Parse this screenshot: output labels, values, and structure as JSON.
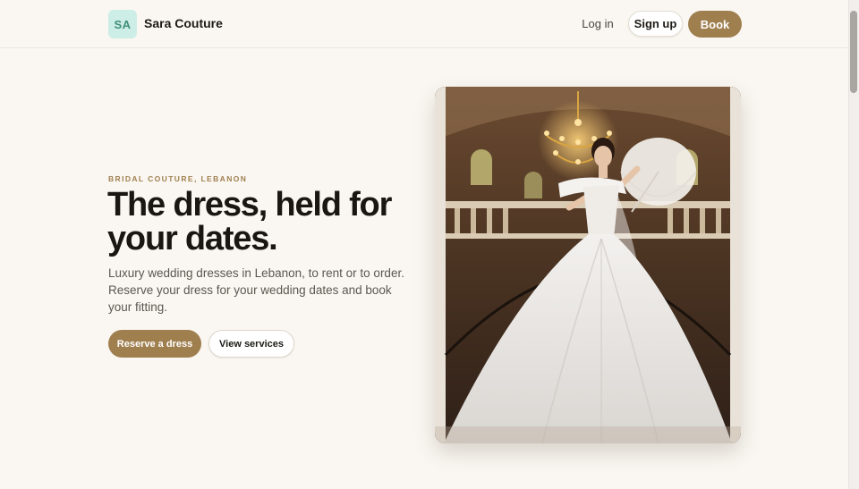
{
  "header": {
    "logo_initials": "SA",
    "brand_name": "Sara Couture",
    "login_label": "Log in",
    "signup_label": "Sign up",
    "book_label": "Book"
  },
  "hero": {
    "eyebrow": "BRIDAL COUTURE, LEBANON",
    "headline": "The dress, held for your dates.",
    "subtext": "Luxury wedding dresses in Lebanon, to rent or to order. Reserve your dress for your wedding dates and book your fitting.",
    "primary_cta": "Reserve a dress",
    "secondary_cta": "View services"
  },
  "colors": {
    "accent": "#a07f4f",
    "background": "#faf7f2",
    "logo_badge": "#cdeee6"
  }
}
